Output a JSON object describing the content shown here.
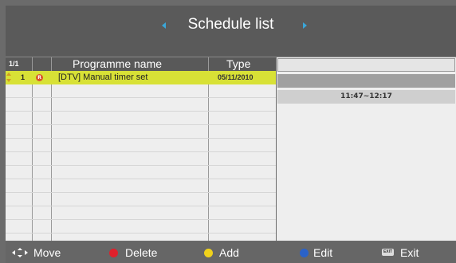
{
  "header": {
    "title": "Schedule list"
  },
  "table": {
    "page": "1/1",
    "columns": {
      "name": "Programme name",
      "type": "Type"
    },
    "rows": [
      {
        "index": "1",
        "status_icon": "R",
        "name": "[DTV] Manual timer set",
        "date": "05/11/2010",
        "selected": true
      }
    ]
  },
  "detail": {
    "time_range": "11:47~12:17"
  },
  "footer": {
    "move": "Move",
    "delete": "Delete",
    "add": "Add",
    "edit": "Edit",
    "exit": "Exit",
    "exit_key": "EXIT"
  },
  "colors": {
    "selected_row": "#d8e136",
    "delete_button": "#e0202b",
    "add_button": "#f0d21c",
    "edit_button": "#2a62c8",
    "header_arrows": "#3aa6d8"
  }
}
